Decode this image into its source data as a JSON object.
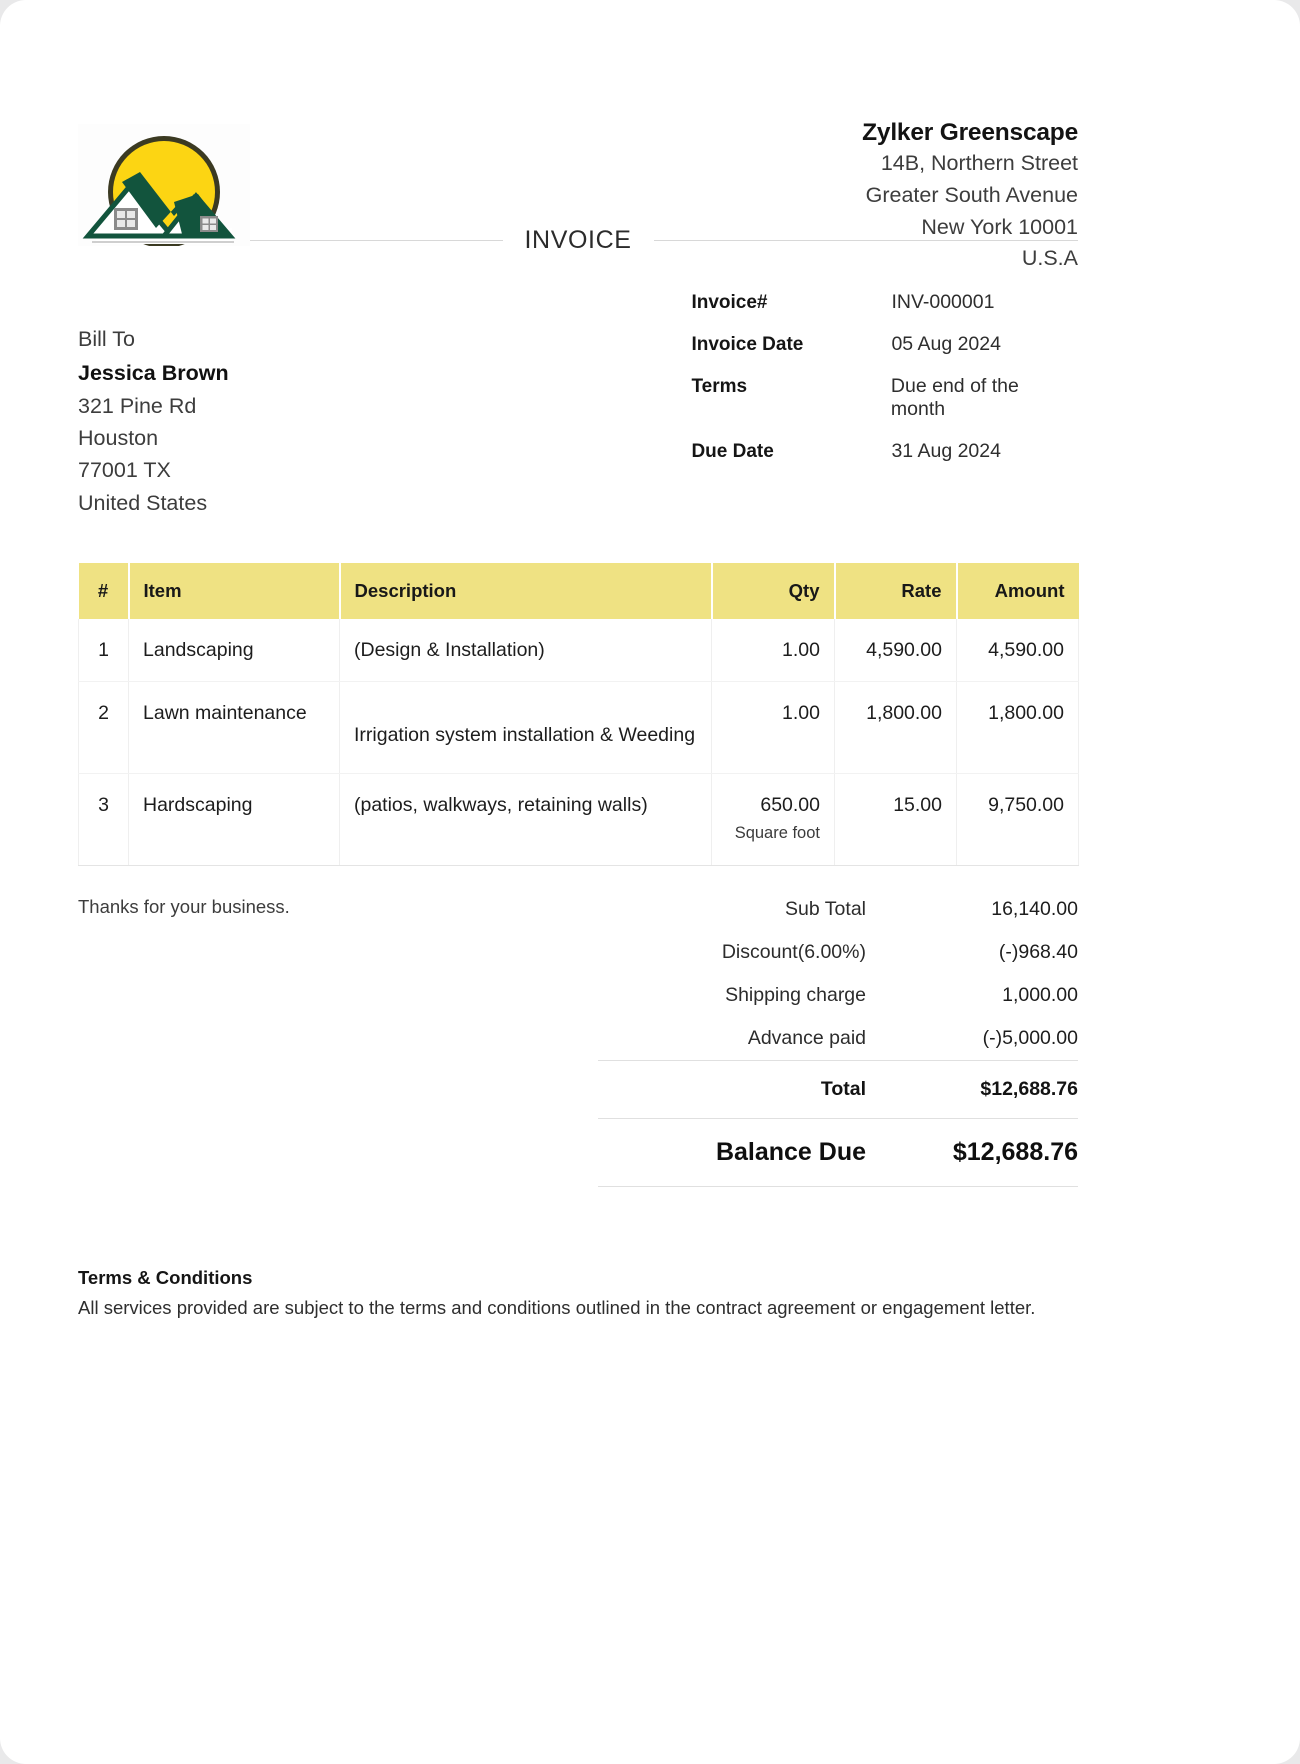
{
  "company": {
    "name": "Zylker Greenscape",
    "address": [
      "14B, Northern Street",
      "Greater South Avenue",
      "New York 10001",
      "U.S.A"
    ],
    "logo_icon": "sun-mountain-house-logo"
  },
  "document": {
    "title": "INVOICE"
  },
  "bill_to": {
    "label": "Bill To",
    "name": "Jessica Brown",
    "address": [
      "321 Pine Rd",
      "Houston",
      "77001 TX",
      "United States"
    ]
  },
  "details": [
    {
      "label": "Invoice#",
      "value": "INV-000001"
    },
    {
      "label": "Invoice Date",
      "value": "05 Aug 2024"
    },
    {
      "label": "Terms",
      "value": "Due end of the month"
    },
    {
      "label": "Due Date",
      "value": "31  Aug 2024"
    }
  ],
  "items_table": {
    "columns": [
      "#",
      "Item",
      "Description",
      "Qty",
      "Rate",
      "Amount"
    ],
    "rows": [
      {
        "num": "1",
        "item": "Landscaping",
        "description": "(Design & Installation)",
        "qty": "1.00",
        "qty_unit": "",
        "rate": "4,590.00",
        "amount": "4,590.00"
      },
      {
        "num": "2",
        "item": "Lawn maintenance",
        "description": "Irrigation system installation & Weeding",
        "qty": "1.00",
        "qty_unit": "",
        "rate": "1,800.00",
        "amount": "1,800.00"
      },
      {
        "num": "3",
        "item": "Hardscaping",
        "description": "(patios, walkways, retaining walls)",
        "qty": "650.00",
        "qty_unit": "Square foot",
        "rate": "15.00",
        "amount": "9,750.00"
      }
    ]
  },
  "thanks_note": "Thanks for your business.",
  "totals": [
    {
      "label": "Sub Total",
      "value": "16,140.00"
    },
    {
      "label": "Discount(6.00%)",
      "value": "(-)968.40"
    },
    {
      "label": "Shipping charge",
      "value": "1,000.00"
    },
    {
      "label": "Advance paid",
      "value": "(-)5,000.00"
    }
  ],
  "total": {
    "label": "Total",
    "value": "$12,688.76"
  },
  "balance_due": {
    "label": "Balance Due",
    "value": "$12,688.76"
  },
  "terms": {
    "title": "Terms & Conditions",
    "body": "All services provided are subject to the terms and conditions outlined in the contract agreement or engagement letter."
  },
  "colors": {
    "table_header_bg": "#EFE283",
    "logo_sun": "#FCD513",
    "logo_green": "#12543D"
  }
}
